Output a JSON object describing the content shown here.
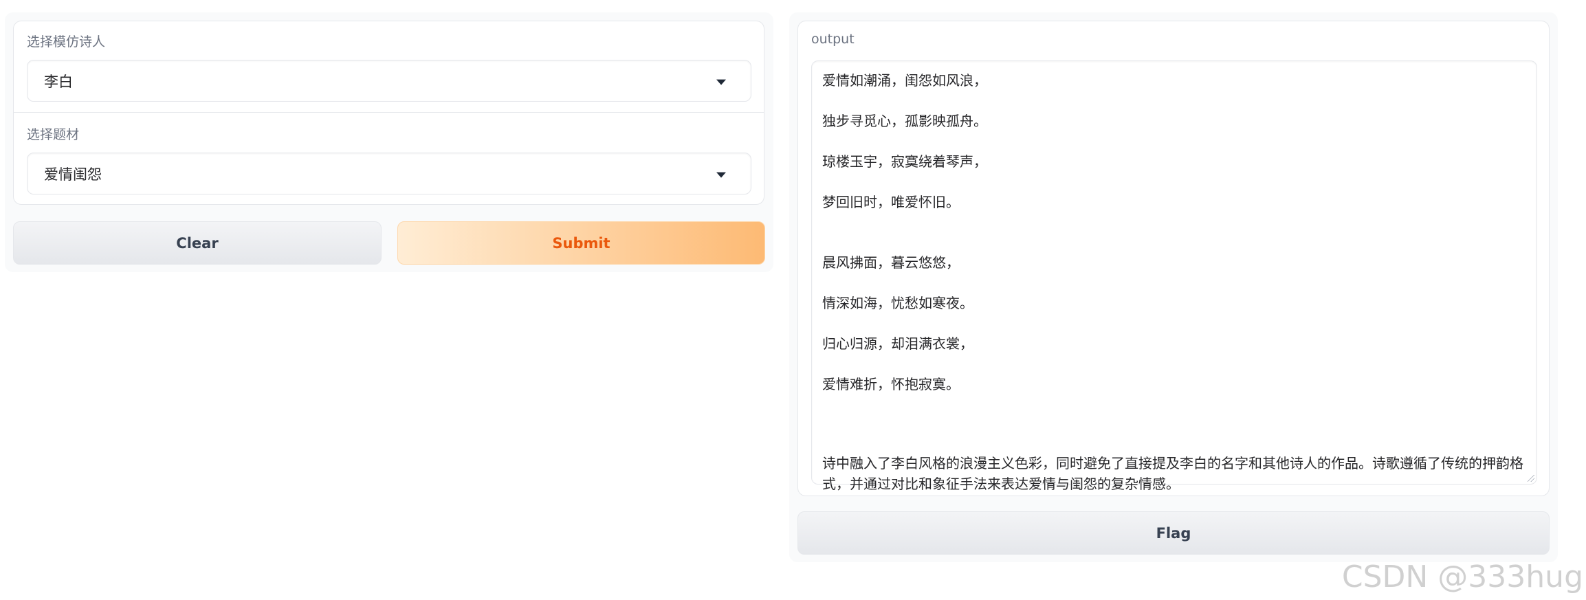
{
  "inputs": {
    "poet": {
      "label": "选择模仿诗人",
      "value": "李白"
    },
    "theme": {
      "label": "选择题材",
      "value": "爱情闺怨"
    }
  },
  "buttons": {
    "clear": "Clear",
    "submit": "Submit",
    "flag": "Flag"
  },
  "output": {
    "label": "output",
    "lines": [
      "爱情如潮涌，闺怨如风浪，",
      "独步寻觅心，孤影映孤舟。",
      "琼楼玉宇，寂寞绕着琴声，",
      "梦回旧时，唯爱怀旧。",
      "晨风拂面，暮云悠悠，",
      "情深如海，忧愁如寒夜。",
      "归心归源，却泪满衣裳，",
      "爱情难折，怀抱寂寞。"
    ],
    "note": "诗中融入了李白风格的浪漫主义色彩，同时避免了直接提及李白的名字和其他诗人的作品。诗歌遵循了传统的押韵格式，并通过对比和象征手法来表达爱情与闺怨的复杂情感。"
  },
  "watermark": "CSDN @333hug",
  "colors": {
    "submit_text": "#ea580c",
    "submit_gradient_start": "#ffedd5",
    "submit_gradient_end": "#fdba74",
    "panel_bg": "#f9fafb",
    "border": "#e5e7eb"
  }
}
